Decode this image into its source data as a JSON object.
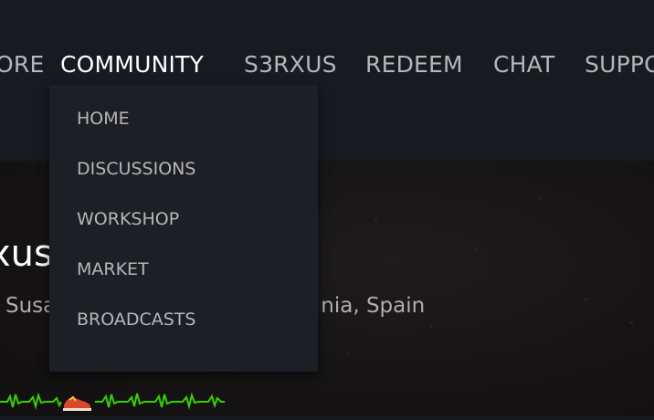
{
  "nav": {
    "store_partial": "ORE",
    "community": "COMMUNITY",
    "username": "S3RXUS",
    "redeem": "REDEEM",
    "chat": "CHAT",
    "support_partial": "SUPPO"
  },
  "community_menu": {
    "items": [
      "HOME",
      "DISCUSSIONS",
      "WORKSHOP",
      "MARKET",
      "BROADCASTS"
    ]
  },
  "profile": {
    "name_partial": "xus",
    "location_left": "Susa",
    "location_right": "nia, Spain"
  },
  "colors": {
    "background": "#171a21",
    "dropdown": "#1d1f27",
    "nav_text": "#b8b6b4",
    "nav_active": "#ffffff",
    "ekg_green": "#38d100"
  },
  "badges": [
    {
      "icon": "heartbeat-line-icon"
    },
    {
      "icon": "racing-shoe-icon"
    },
    {
      "icon": "heartbeat-line-icon"
    }
  ]
}
